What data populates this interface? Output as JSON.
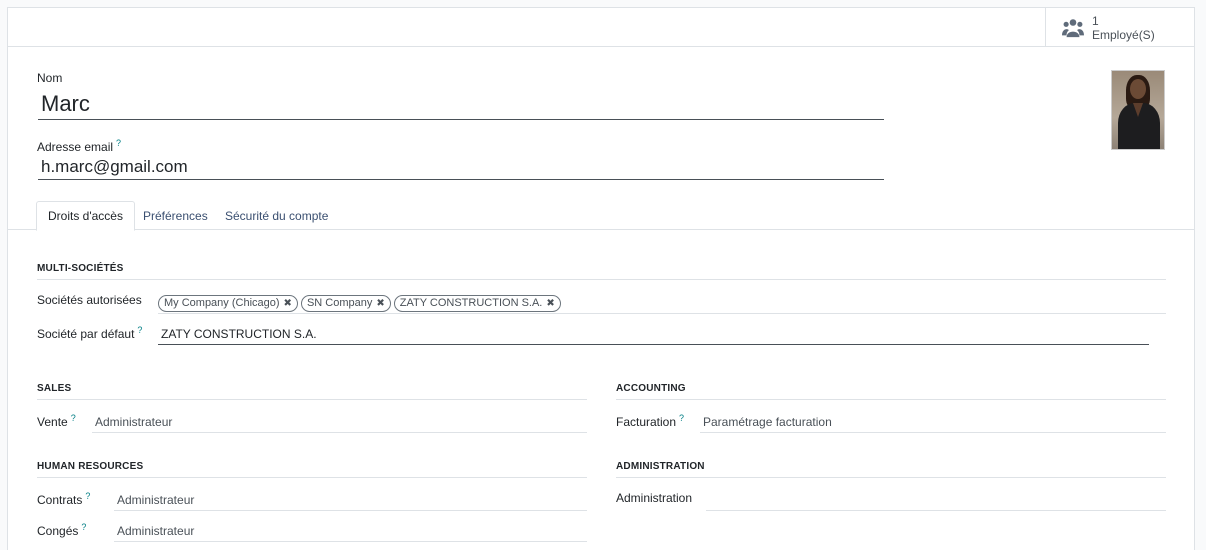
{
  "stat_button": {
    "value": "1",
    "label": "Employé(S)",
    "icon": "users-icon"
  },
  "fields": {
    "name_label": "Nom",
    "name_value": "Marc",
    "email_label": "Adresse email",
    "email_value": "h.marc@gmail.com",
    "help_mark": "?"
  },
  "avatar": {
    "icon": "user-photo"
  },
  "tabs": [
    {
      "label": "Droits d'accès",
      "active": true
    },
    {
      "label": "Préférences",
      "active": false
    },
    {
      "label": "Sécurité du compte",
      "active": false
    }
  ],
  "multi_company": {
    "title": "MULTI-SOCIÉTÉS",
    "allowed_label": "Sociétés autorisées",
    "allowed_tags": [
      "My Company (Chicago)",
      "SN Company",
      "ZATY CONSTRUCTION S.A."
    ],
    "default_label": "Société par défaut",
    "default_value": "ZATY CONSTRUCTION S.A."
  },
  "sales": {
    "title": "SALES",
    "label": "Vente",
    "value": "Administrateur"
  },
  "accounting": {
    "title": "ACCOUNTING",
    "label": "Facturation",
    "value": "Paramétrage facturation"
  },
  "hr": {
    "title": "HUMAN RESOURCES",
    "contracts_label": "Contrats",
    "contracts_value": "Administrateur",
    "leave_label": "Congés",
    "leave_value": "Administrateur"
  },
  "administration": {
    "title": "ADMINISTRATION",
    "label": "Administration",
    "value": ""
  },
  "colors": {
    "accent": "#017e84",
    "tab_text": "#3a4f70",
    "border": "#dee2e6"
  }
}
